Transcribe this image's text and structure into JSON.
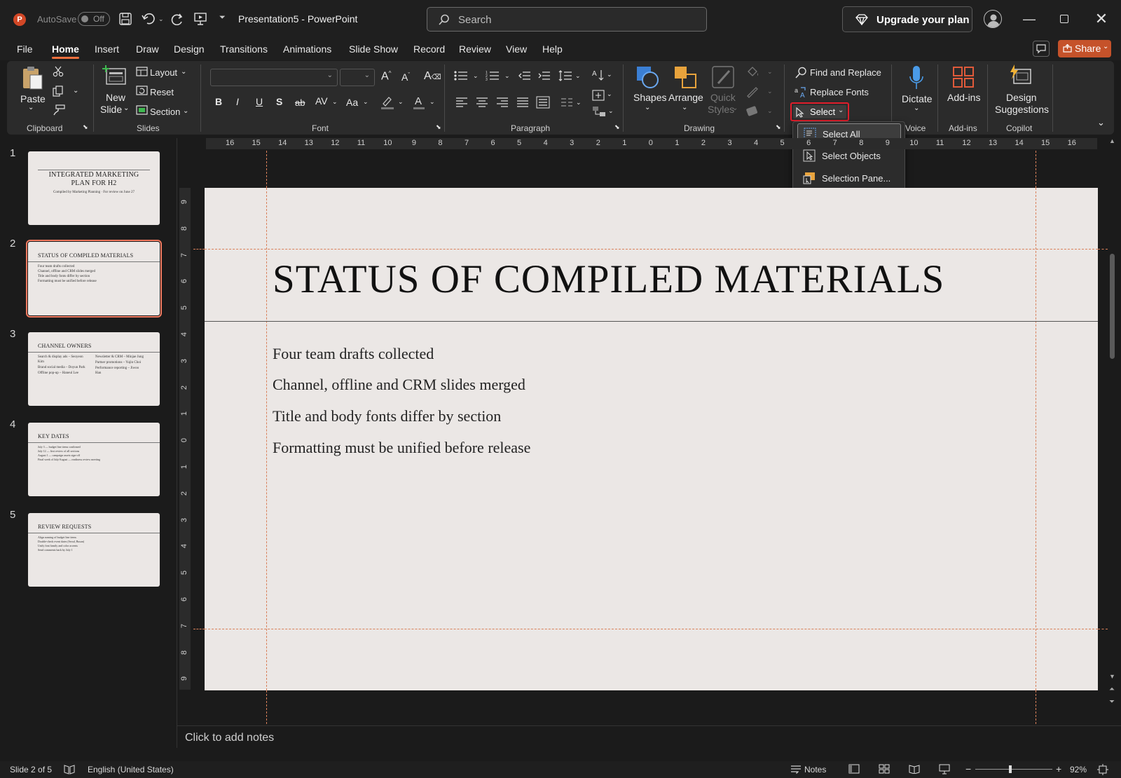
{
  "titlebar": {
    "autosave_label": "AutoSave",
    "autosave_state": "Off",
    "doc_title": "Presentation5  -  PowerPoint",
    "search_placeholder": "Search",
    "upgrade_label": "Upgrade your plan"
  },
  "tabs": [
    "File",
    "Home",
    "Insert",
    "Draw",
    "Design",
    "Transitions",
    "Animations",
    "Slide Show",
    "Record",
    "Review",
    "View",
    "Help"
  ],
  "share_label": "Share",
  "ribbon": {
    "clipboard": {
      "group": "Clipboard",
      "paste": "Paste"
    },
    "slides": {
      "group": "Slides",
      "new_slide_1": "New",
      "new_slide_2": "Slide",
      "layout": "Layout",
      "reset": "Reset",
      "section": "Section"
    },
    "font": {
      "group": "Font"
    },
    "paragraph": {
      "group": "Paragraph"
    },
    "drawing": {
      "group": "Drawing",
      "shapes": "Shapes",
      "arrange": "Arrange",
      "quick_styles_1": "Quick",
      "quick_styles_2": "Styles"
    },
    "editing": {
      "find_replace": "Find and Replace",
      "replace_fonts": "Replace Fonts",
      "select": "Select"
    },
    "voice": {
      "group": "Voice",
      "dictate": "Dictate"
    },
    "addins": {
      "group": "Add-ins",
      "label": "Add-ins"
    },
    "copilot": {
      "group": "Copilot",
      "design_1": "Design",
      "design_2": "Suggestions"
    }
  },
  "select_menu": [
    "Select All",
    "Select Objects",
    "Selection Pane..."
  ],
  "thumbnails": [
    {
      "num": "1",
      "title_1": "Integrated Marketing",
      "title_2": "Plan for H2",
      "sub": "Compiled by Marketing Planning · For review on June 27"
    },
    {
      "num": "2",
      "title": "Status of Compiled Materials",
      "lines": [
        "Four team drafts collected",
        "Channel, offline and CRM slides merged",
        "Title and body fonts differ by section",
        "Formatting must be unified before release"
      ]
    },
    {
      "num": "3",
      "title": "Channel Owners",
      "left": [
        "Search & display ads – Seoyeon",
        "Kim",
        "Brand social media – Doyun Park",
        "Offline pop-up – Haneul Lee"
      ],
      "right": [
        "Newsletter & CRM – Minjae Jung",
        "Partner promotions – Yujin Choi",
        "Performance reporting – Jiwoo",
        "Han"
      ]
    },
    {
      "num": "4",
      "title": "Key Dates",
      "lines": [
        "July 3 — budget line items confirmed",
        "July 12 — first review of all sections",
        "August 1 — campaign assets sign-off",
        "Final week of July/August — readiness review meeting"
      ]
    },
    {
      "num": "5",
      "title": "Review Requests",
      "lines": [
        "Align naming of budget line items",
        "Double-check event dates (Seoul, Busan)",
        "Unify font family and color accents",
        "Send comments back by July 1"
      ]
    }
  ],
  "hruler": [
    "16",
    "15",
    "14",
    "13",
    "12",
    "11",
    "10",
    "9",
    "8",
    "7",
    "6",
    "5",
    "4",
    "3",
    "2",
    "1",
    "0",
    "1",
    "2",
    "3",
    "4",
    "5",
    "6",
    "7",
    "8",
    "9",
    "10",
    "11",
    "12",
    "13",
    "14",
    "15",
    "16"
  ],
  "vruler": [
    "9",
    "8",
    "7",
    "6",
    "5",
    "4",
    "3",
    "2",
    "1",
    "0",
    "1",
    "2",
    "3",
    "4",
    "5",
    "6",
    "7",
    "8",
    "9"
  ],
  "slide": {
    "title": "Status of Compiled Materials",
    "bullets": [
      "Four team drafts collected",
      "Channel, offline and CRM slides merged",
      "Title and body fonts differ by section",
      "Formatting must be unified before release"
    ]
  },
  "notes_placeholder": "Click to add notes",
  "status": {
    "slide_info": "Slide 2 of 5",
    "language": "English (United States)",
    "notes": "Notes",
    "zoom": "92%"
  }
}
